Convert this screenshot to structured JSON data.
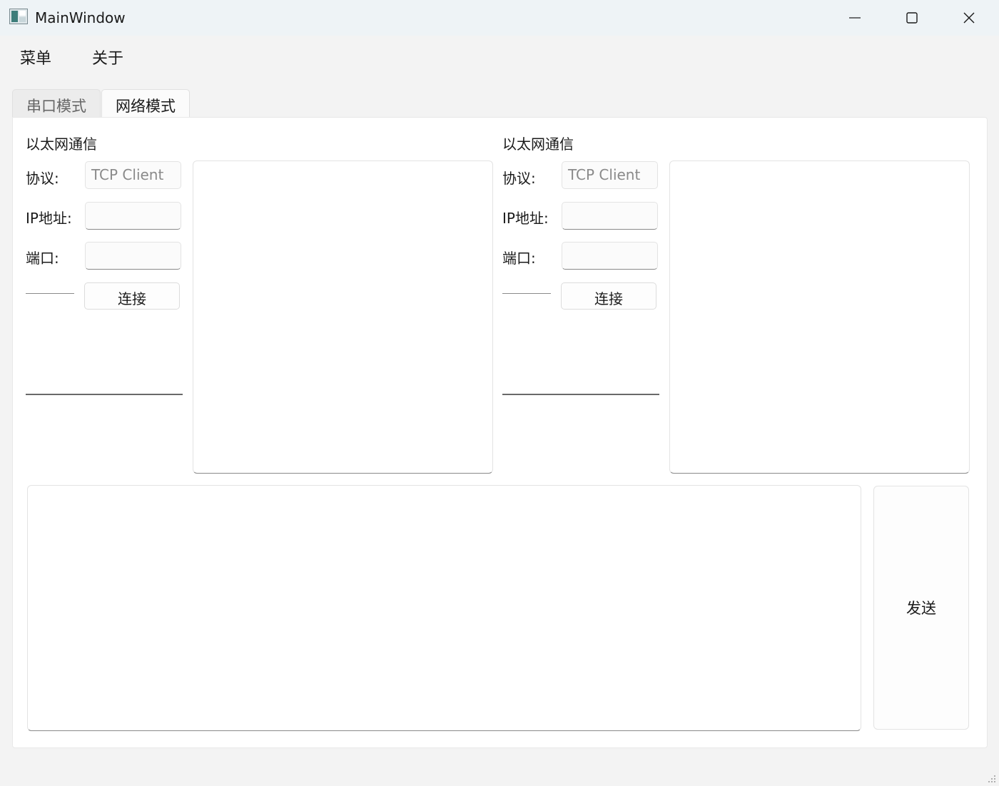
{
  "window": {
    "title": "MainWindow"
  },
  "menubar": {
    "items": [
      {
        "label": "菜单"
      },
      {
        "label": "关于"
      }
    ]
  },
  "tabs": [
    {
      "label": "串口模式"
    },
    {
      "label": "网络模式",
      "active": true
    }
  ],
  "left_group": {
    "title": "以太网通信",
    "protocol_label": "协议:",
    "protocol_value": "TCP Client",
    "ip_label": "IP地址:",
    "ip_value": "",
    "port_label": "端口:",
    "port_value": "",
    "connect_label": "连接"
  },
  "right_group": {
    "title": "以太网通信",
    "protocol_label": "协议:",
    "protocol_value": "TCP Client",
    "ip_label": "IP地址:",
    "ip_value": "",
    "port_label": "端口:",
    "port_value": "",
    "connect_label": "连接"
  },
  "send": {
    "label": "发送",
    "text": ""
  },
  "colors": {
    "window_bg": "#f3f3f3",
    "titlebar_bg": "#eef3f6",
    "panel_bg": "#ffffff"
  }
}
